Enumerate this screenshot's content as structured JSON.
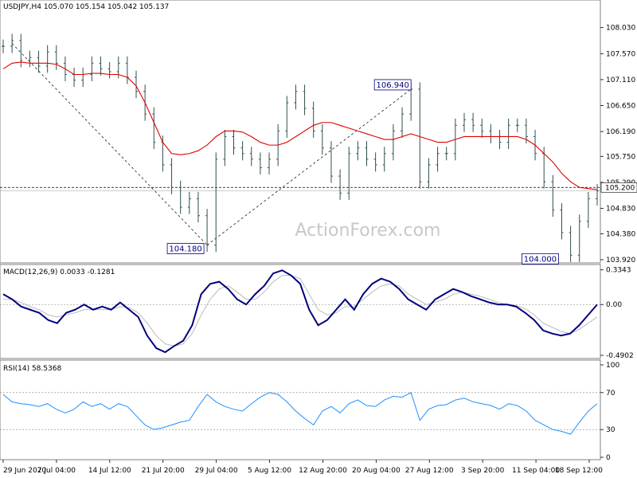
{
  "chart_data": [
    {
      "type": "candlestick",
      "title": "USDJPY,H4  105.070 105.154 105.042 105.137",
      "watermark": "ActionForex.com",
      "yticks": [
        "108.030",
        "107.570",
        "107.110",
        "106.650",
        "106.190",
        "105.750",
        "105.290",
        "104.830",
        "104.380",
        "103.920"
      ],
      "ylim": [
        103.92,
        108.35
      ],
      "series": [
        {
          "name": "price",
          "close": [
            107.7,
            107.8,
            107.45,
            107.5,
            107.35,
            107.6,
            107.4,
            107.2,
            107.1,
            107.2,
            107.4,
            107.3,
            107.25,
            107.4,
            107.15,
            106.9,
            106.5,
            106.0,
            105.6,
            105.2,
            104.85,
            105.0,
            104.7,
            104.18,
            105.7,
            106.1,
            105.9,
            105.8,
            105.7,
            105.55,
            105.7,
            106.2,
            106.7,
            106.9,
            106.6,
            106.2,
            105.9,
            105.4,
            105.1,
            105.8,
            105.9,
            105.7,
            105.6,
            105.8,
            106.2,
            106.5,
            106.94,
            105.3,
            105.6,
            105.8,
            105.8,
            106.3,
            106.4,
            106.3,
            106.2,
            106.1,
            106.0,
            106.3,
            106.3,
            106.1,
            105.8,
            105.3,
            104.8,
            104.4,
            104.0,
            104.6,
            105.0,
            105.14
          ]
        },
        {
          "name": "moving average",
          "values": [
            107.3,
            107.4,
            107.42,
            107.4,
            107.4,
            107.4,
            107.38,
            107.3,
            107.2,
            107.2,
            107.22,
            107.22,
            107.2,
            107.2,
            107.15,
            107.0,
            106.7,
            106.35,
            106.0,
            105.8,
            105.78,
            105.8,
            105.85,
            105.95,
            106.1,
            106.2,
            106.2,
            106.18,
            106.1,
            106.0,
            105.95,
            105.95,
            106.0,
            106.1,
            106.2,
            106.3,
            106.35,
            106.35,
            106.3,
            106.25,
            106.2,
            106.15,
            106.1,
            106.05,
            106.05,
            106.1,
            106.15,
            106.1,
            106.05,
            106.0,
            106.0,
            106.05,
            106.1,
            106.1,
            106.1,
            106.1,
            106.1,
            106.1,
            106.1,
            106.05,
            105.95,
            105.8,
            105.65,
            105.45,
            105.3,
            105.2,
            105.18,
            105.16
          ]
        }
      ],
      "levels": [
        105.2,
        105.137
      ],
      "annotations": [
        {
          "label": "104.180",
          "value": 104.18
        },
        {
          "label": "106.940",
          "value": 106.94
        },
        {
          "label": "104.000",
          "value": 104.0
        }
      ],
      "current_price_label": "105.200",
      "current_price_label2": "105.137"
    },
    {
      "type": "line",
      "title": "MACD(12,26,9) 0.0033 -0.1281",
      "yticks": [
        "0.3343",
        "0.00",
        "-0.4902"
      ],
      "ylim": [
        -0.49,
        0.34
      ],
      "series": [
        {
          "name": "MACD",
          "values": [
            0.1,
            0.05,
            -0.02,
            -0.05,
            -0.08,
            -0.15,
            -0.18,
            -0.08,
            -0.05,
            0.0,
            -0.05,
            -0.02,
            -0.05,
            0.02,
            -0.05,
            -0.12,
            -0.3,
            -0.42,
            -0.46,
            -0.4,
            -0.35,
            -0.2,
            0.1,
            0.2,
            0.22,
            0.15,
            0.05,
            0.0,
            0.1,
            0.18,
            0.3,
            0.33,
            0.28,
            0.2,
            -0.05,
            -0.2,
            -0.15,
            -0.05,
            0.05,
            -0.05,
            0.1,
            0.2,
            0.25,
            0.22,
            0.15,
            0.05,
            0.0,
            -0.05,
            0.05,
            0.1,
            0.15,
            0.12,
            0.08,
            0.05,
            0.02,
            0.0,
            0.0,
            -0.02,
            -0.08,
            -0.15,
            -0.25,
            -0.28,
            -0.3,
            -0.28,
            -0.2,
            -0.1,
            0.0
          ]
        },
        {
          "name": "Signal",
          "values": [
            0.05,
            0.05,
            0.02,
            -0.02,
            -0.05,
            -0.1,
            -0.12,
            -0.1,
            -0.08,
            -0.05,
            -0.05,
            -0.05,
            -0.05,
            -0.02,
            -0.03,
            -0.08,
            -0.18,
            -0.3,
            -0.38,
            -0.4,
            -0.38,
            -0.28,
            -0.1,
            0.05,
            0.15,
            0.18,
            0.12,
            0.05,
            0.05,
            0.12,
            0.22,
            0.28,
            0.28,
            0.25,
            0.1,
            -0.05,
            -0.1,
            -0.08,
            -0.02,
            -0.02,
            0.05,
            0.12,
            0.18,
            0.2,
            0.18,
            0.1,
            0.05,
            0.0,
            0.02,
            0.05,
            0.1,
            0.12,
            0.1,
            0.08,
            0.05,
            0.02,
            0.0,
            -0.01,
            -0.04,
            -0.1,
            -0.18,
            -0.22,
            -0.26,
            -0.28,
            -0.24,
            -0.18,
            -0.12
          ]
        }
      ]
    },
    {
      "type": "line",
      "title": "RSI(14) 58.5368",
      "yticks": [
        "100",
        "70",
        "30",
        "0"
      ],
      "ylim": [
        0,
        100
      ],
      "series": [
        {
          "name": "RSI",
          "values": [
            68,
            60,
            58,
            57,
            55,
            58,
            52,
            48,
            52,
            60,
            55,
            58,
            52,
            58,
            55,
            45,
            35,
            30,
            32,
            35,
            38,
            40,
            55,
            68,
            60,
            55,
            52,
            50,
            58,
            65,
            70,
            68,
            60,
            50,
            42,
            35,
            50,
            55,
            48,
            58,
            62,
            56,
            55,
            62,
            66,
            65,
            70,
            40,
            52,
            56,
            57,
            62,
            64,
            60,
            58,
            56,
            52,
            58,
            56,
            50,
            40,
            35,
            30,
            28,
            25,
            38,
            50,
            58
          ]
        }
      ],
      "levels": [
        70,
        30
      ]
    }
  ],
  "x_ticks": [
    "29 Jun 2020",
    "7 Jul 04:00",
    "14 Jul 12:00",
    "21 Jul 20:00",
    "29 Jul 04:00",
    "5 Aug 12:00",
    "12 Aug 20:00",
    "20 Aug 04:00",
    "27 Aug 12:00",
    "3 Sep 20:00",
    "11 Sep 04:00",
    "18 Sep 12:00"
  ]
}
